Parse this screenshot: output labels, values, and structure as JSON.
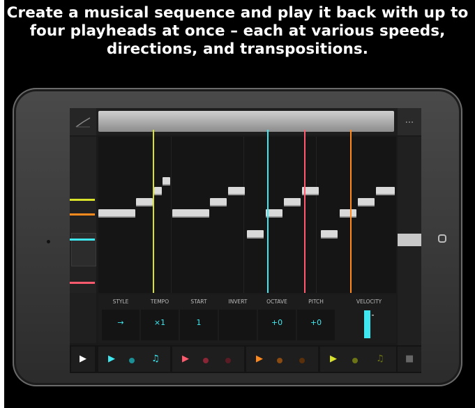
{
  "caption": {
    "line1": "Create a musical sequence and play it back with up to",
    "line2": "four playheads at once – each at various speeds,",
    "line3": "directions, and transpositions."
  },
  "topbar": {
    "menu_icon": "...",
    "left_icon": "ramp-icon"
  },
  "params": {
    "labels": [
      "STYLE",
      "TEMPO",
      "START",
      "INVERT",
      "OCTAVE",
      "PITCH",
      "VELOCITY"
    ],
    "style_value": "→",
    "tempo_value": "×1",
    "start_value": "1",
    "octave_value": "+0",
    "pitch_value": "+0"
  },
  "playheads": [
    {
      "name": "yellow",
      "color": "#d8e22b"
    },
    {
      "name": "cyan",
      "color": "#3fe8f0"
    },
    {
      "name": "pink",
      "color": "#ff5a6e"
    },
    {
      "name": "orange",
      "color": "#ff8a1e"
    }
  ],
  "bottom": {
    "play_icon": "▶",
    "stop_icon": "■",
    "track_icons": [
      "▶",
      "♫",
      "▶",
      "▶",
      "▶",
      "♫"
    ]
  }
}
